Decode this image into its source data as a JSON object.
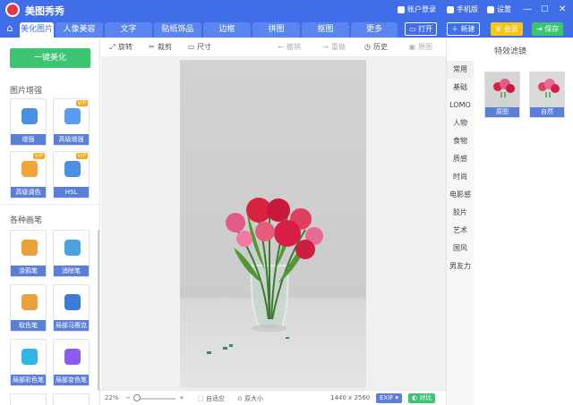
{
  "app": {
    "name": "美图秀秀"
  },
  "titlebar": {
    "account": "账户登录",
    "phone": "手机版",
    "settings": "设置"
  },
  "tabs": [
    "美化图片",
    "人像美容",
    "文字",
    "贴纸饰品",
    "边框",
    "拼图",
    "抠图",
    "更多"
  ],
  "actions": {
    "open": "打开",
    "new": "新建",
    "vip": "会员",
    "save": "保存"
  },
  "left": {
    "onekey": "一键美化",
    "section1": "图片增强",
    "tools1": [
      {
        "label": "增强",
        "vip": false,
        "color": "#4a90e2"
      },
      {
        "label": "高级增强",
        "vip": true,
        "color": "#5b9bf0"
      },
      {
        "label": "高级调色",
        "vip": true,
        "color": "#f2a33a"
      },
      {
        "label": "HSL",
        "vip": true,
        "color": "#4a90e2"
      }
    ],
    "section2": "各种画笔",
    "tools2": [
      {
        "label": "涂鸦笔",
        "vip": false,
        "color": "#e9a23b"
      },
      {
        "label": "消除笔",
        "vip": false,
        "color": "#4aa3e0"
      },
      {
        "label": "取色笔",
        "vip": false,
        "color": "#e9a23b"
      },
      {
        "label": "局部马赛克",
        "vip": false,
        "color": "#3a7bd5"
      },
      {
        "label": "局部彩色笔",
        "vip": false,
        "color": "#2fb5e8"
      },
      {
        "label": "局部变色笔",
        "vip": false,
        "color": "#8a5cf0"
      }
    ],
    "vip_badge": "VIP"
  },
  "toolbar": {
    "rotate": "旋转",
    "crop": "裁剪",
    "size": "尺寸",
    "undo": "撤销",
    "redo": "重做",
    "history": "历史",
    "original": "原图"
  },
  "status": {
    "zoom": "22%",
    "fit": "自适应",
    "actual": "原大小",
    "dimensions": "1440 x 2560",
    "exif": "EXIF",
    "compare": "对比"
  },
  "right": {
    "title": "特效滤镜",
    "categories": [
      "常用",
      "基础",
      "LOMO",
      "人物",
      "食物",
      "质感",
      "时尚",
      "电影感",
      "胶片",
      "艺术",
      "国风",
      "男友力"
    ],
    "filters": [
      "原图",
      "自然"
    ]
  },
  "colors": {
    "accent": "#3f6ee8",
    "green": "#3cc473",
    "gold": "#f5c518",
    "label_bg": "#5b7fd9"
  }
}
